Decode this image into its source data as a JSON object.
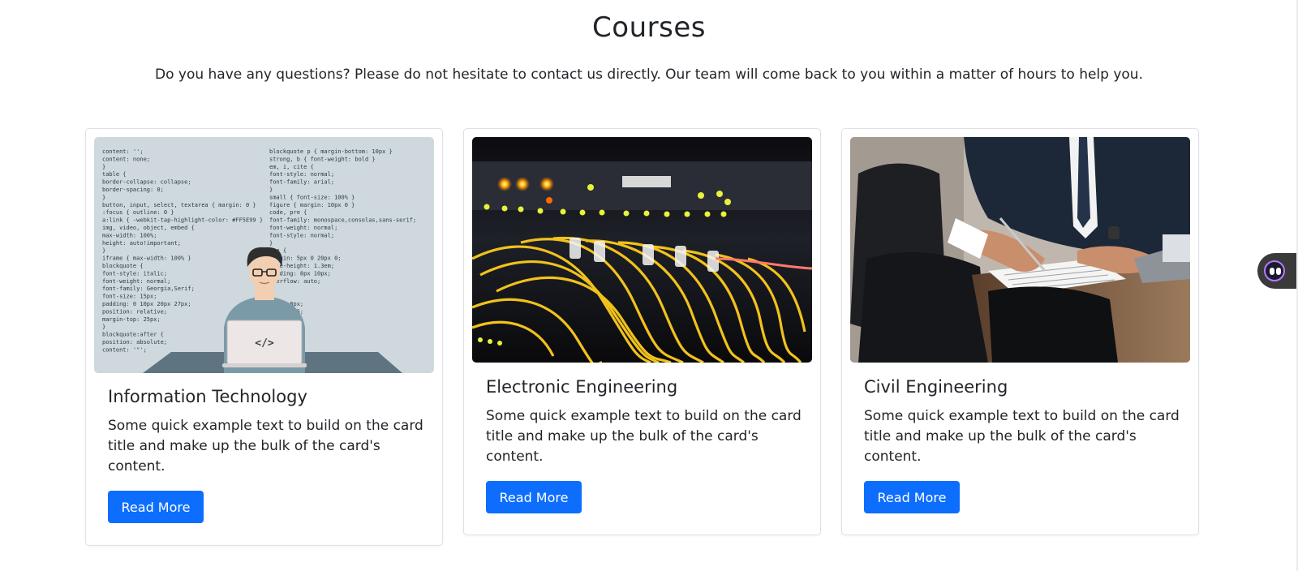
{
  "header": {
    "title": "Courses",
    "subtitle": "Do you have any questions? Please do not hesitate to contact us directly. Our team will come back to you within a matter of hours to help you."
  },
  "cards": [
    {
      "title": "Information Technology",
      "text": "Some quick example text to build on the card title and make up the bulk of the card's content.",
      "button_label": "Read More",
      "image_icon": "developer-illustration-icon",
      "code_left": [
        "    content: '';",
        "    content: none;",
        "}",
        "table {",
        "    border-collapse: collapse;",
        "    border-spacing: 0;",
        "}",
        "button, input, select, textarea { margin: 0 }",
        ":focus { outline: 0 }",
        "a:link { -webkit-tap-highlight-color: #FF5E99 }",
        "img, video, object, embed {",
        "    max-width: 100%;",
        "    height: auto!important;",
        "}",
        "iframe { max-width: 100% }",
        "blockquote {",
        "    font-style: italic;",
        "    font-weight: normal;",
        "    font-family: Georgia,Serif;",
        "    font-size: 15px;",
        "    padding: 0 10px 20px 27px;",
        "    position: relative;",
        "    margin-top: 25px;",
        "}",
        "blockquote:after {",
        "    position: absolute;",
        "    content: '\"';"
      ],
      "code_right": [
        "blockquote p { margin-bottom: 10px }",
        "strong, b { font-weight: bold }",
        "em, i, cite {",
        "    font-style: normal;",
        "    font-family: arial;",
        "}",
        "small { font-size: 100% }",
        "figure { margin: 10px 0 }",
        "code, pre {",
        "    font-family: monospace,consolas,sans-serif;",
        "    font-weight: normal;",
        "    font-style: normal;",
        "}",
        "pre {",
        "    margin: 5px 0 20px 0;",
        "    line-height: 1.3em;",
        "    padding: 8px 10px;",
        "    overflow: auto;",
        "}",
        "",
        "        ng: 0 8px;",
        "        ight: 1.5;",
        "",
        "",
        "        1px 6px;",
        "        0 2px;",
        "        lack"
      ],
      "laptop_label": "</>"
    },
    {
      "title": "Electronic Engineering",
      "text": "Some quick example text to build on the card title and make up the bulk of the card's content.",
      "button_label": "Read More",
      "image_icon": "network-cables-photo-icon"
    },
    {
      "title": "Civil Engineering",
      "text": "Some quick example text to build on the card title and make up the bulk of the card's content.",
      "button_label": "Read More",
      "image_icon": "businessman-signing-photo-icon"
    }
  ],
  "widget": {
    "icon": "assistant-bot-icon",
    "accent": "#b57bff"
  },
  "colors": {
    "primary": "#0d6efd",
    "text": "#212529",
    "border": "#dee2e6"
  }
}
